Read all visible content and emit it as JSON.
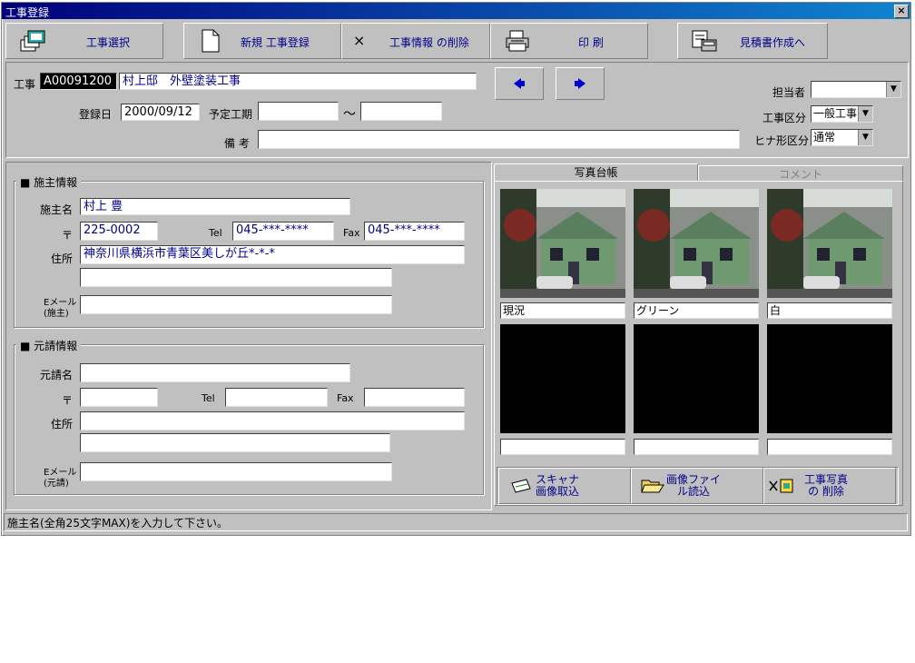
{
  "window": {
    "title": "工事登録",
    "close": "×"
  },
  "toolbar": {
    "select": "工事選択",
    "new": "新規 工事登録",
    "delete": "工事情報 の削除",
    "delete_mark": "×",
    "print": "印 刷",
    "estimate": "見積書作成へ"
  },
  "header": {
    "kouji_label": "工事",
    "kouji_code": "A00091200",
    "kouji_name": "村上邸　外壁塗装工事",
    "toroku_label": "登録日",
    "toroku_date": "2000/09/12",
    "yotei_label": "予定工期",
    "yotei_from": "",
    "tilde": "～",
    "yotei_to": "",
    "biko_label": "備 考",
    "biko_value": "",
    "tanto_label": "担当者",
    "tanto_value": "",
    "kubun_label": "工事区分",
    "kubun_value": "一般工事",
    "hina_label": "ヒナ形区分",
    "hina_value": "通常",
    "prev": "◆",
    "next": "◆"
  },
  "owner": {
    "group_title": "■  施主情報",
    "name_label": "施主名",
    "name": "村上  豊",
    "zip_label": "〒",
    "zip": "225-0002",
    "tel_label": "Tel",
    "tel": "045-***-****",
    "fax_label": "Fax",
    "fax": "045-***-****",
    "addr_label": "住所",
    "addr1": "神奈川県横浜市青葉区美しが丘*-*-*",
    "addr2": "",
    "email_label1": "Eメール",
    "email_label2": "(施主)",
    "email": ""
  },
  "contractor": {
    "group_title": "■  元請情報",
    "name_label": "元請名",
    "name": "",
    "zip_label": "〒",
    "zip": "",
    "tel_label": "Tel",
    "tel": "",
    "fax_label": "Fax",
    "fax": "",
    "addr_label": "住所",
    "addr1": "",
    "addr2": "",
    "email_label1": "Eメール",
    "email_label2": "(元請)",
    "email": ""
  },
  "photos": {
    "tab_ledger": "写真台帳",
    "tab_comment": "コメント",
    "captions": [
      "現況",
      "グリーン",
      "白",
      "",
      "",
      ""
    ],
    "scan": "スキャナ\n画像取込",
    "file": "画像ファイ\nル読込",
    "remove": "工事写真\nの 削除"
  },
  "status": "施主名(全角25文字MAX)を入力して下さい。",
  "colors": {
    "title_bar": "#00007b",
    "window_bg": "#c0c0c0",
    "house_green": "#6f9a6f"
  }
}
